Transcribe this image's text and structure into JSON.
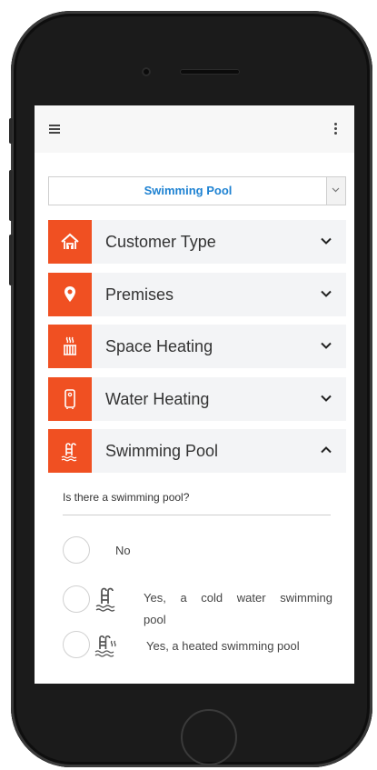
{
  "header": {
    "menu_icon": "hamburger-menu-icon",
    "more_icon": "vertical-dots-icon"
  },
  "category_select": {
    "value": "Swimming Pool",
    "arrow_icon": "chevron-down-icon",
    "text_color": "#1e82d2"
  },
  "sections": [
    {
      "label": "Customer Type",
      "icon": "house-icon",
      "expanded": false
    },
    {
      "label": "Premises",
      "icon": "map-pin-icon",
      "expanded": false
    },
    {
      "label": "Space Heating",
      "icon": "radiator-icon",
      "expanded": false
    },
    {
      "label": "Water Heating",
      "icon": "water-heater-icon",
      "expanded": false
    },
    {
      "label": "Swimming Pool",
      "icon": "pool-ladder-icon",
      "expanded": true
    }
  ],
  "accent_color": "#f05022",
  "pool_panel": {
    "question": "Is there a swimming pool?",
    "options": [
      {
        "label": "No",
        "icon": null,
        "selected": false
      },
      {
        "label_line1": "Yes, a cold water swimming",
        "label_line2": "pool",
        "icon": "pool-ladder-icon",
        "selected": false
      },
      {
        "label": "Yes, a heated swimming pool",
        "icon": "heated-pool-icon",
        "selected": false
      }
    ]
  }
}
